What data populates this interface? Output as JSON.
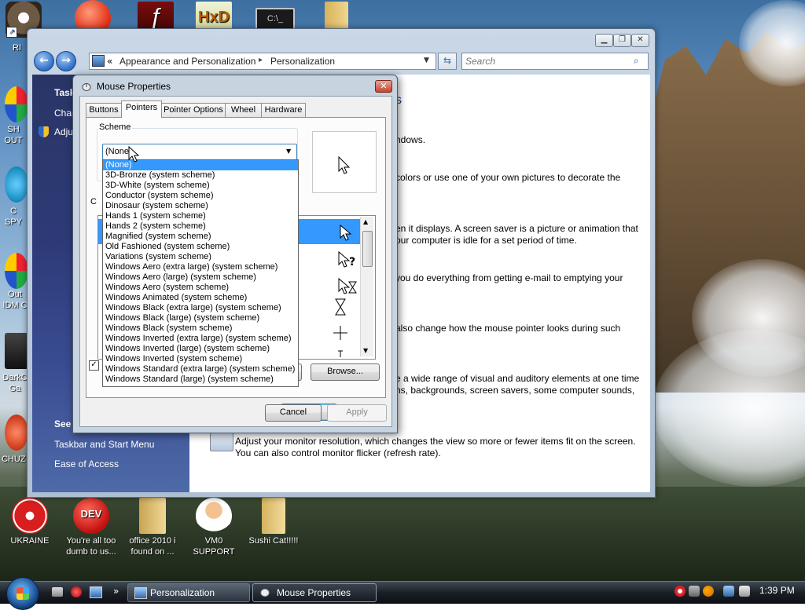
{
  "desktop": {
    "icons_top": [
      {
        "label": "RI",
        "name": "raccoon"
      },
      {
        "label": "",
        "name": "p-app"
      },
      {
        "label": "",
        "name": "flash"
      },
      {
        "label": "",
        "name": "hxd"
      },
      {
        "label": "",
        "name": "cmd"
      },
      {
        "label": "",
        "name": "folder"
      }
    ],
    "icons_left": [
      {
        "label": "SH OUT",
        "name": "sh-out"
      },
      {
        "label": "C SPY",
        "name": "spy"
      },
      {
        "label": "Out IDM C",
        "name": "idm"
      },
      {
        "label": "DarkC Ga",
        "name": "darkc"
      },
      {
        "label": "CHUZ",
        "name": "chuz"
      }
    ],
    "icons_bottom": [
      {
        "label": "UKRAINE",
        "name": "ukraine"
      },
      {
        "label": "You're all too dumb to us...",
        "name": "devcpp"
      },
      {
        "label": "office 2010 i found on ...",
        "name": "office"
      },
      {
        "label": "VM0 SUPPORT",
        "name": "vm0"
      },
      {
        "label": "Sushi Cat!!!!!",
        "name": "sushi"
      }
    ]
  },
  "explorer": {
    "breadcrumb": [
      "Appearance and Personalization",
      "Personalization"
    ],
    "search_placeholder": "Search",
    "left_pane": {
      "top_items": [
        "Task",
        "Char",
        "Adju"
      ],
      "see_also": "See",
      "links": [
        "Taskbar and Start Menu",
        "Ease of Access"
      ]
    },
    "content_fragments": [
      "s",
      "ndows.",
      "colors or use one of your own pictures to decorate the",
      "en it displays. A screen saver is a picture or animation that",
      "our computer is idle for a set period of time.",
      "you do everything from getting e-mail to emptying your",
      "also change how the mouse pointer looks during such",
      "e a wide range of visual and auditory elements at one time",
      "ns, backgrounds, screen savers, some computer sounds,",
      "Adjust your monitor resolution, which changes the view so more or fewer items fit on the screen.",
      "You can also control monitor flicker (refresh rate)."
    ]
  },
  "dialog": {
    "title": "Mouse Properties",
    "tabs": [
      "Buttons",
      "Pointers",
      "Pointer Options",
      "Wheel",
      "Hardware"
    ],
    "active_tab": "Pointers",
    "scheme_label": "Scheme",
    "scheme_value": "(None)",
    "customize_label_fragment": "C",
    "scheme_options": [
      "(None)",
      "3D-Bronze (system scheme)",
      "3D-White (system scheme)",
      "Conductor (system scheme)",
      "Dinosaur (system scheme)",
      "Hands 1 (system scheme)",
      "Hands 2 (system scheme)",
      "Magnified (system scheme)",
      "Old Fashioned (system scheme)",
      "Variations (system scheme)",
      "Windows Aero (extra large) (system scheme)",
      "Windows Aero (large) (system scheme)",
      "Windows Aero (system scheme)",
      "Windows Animated (system scheme)",
      "Windows Black (extra large) (system scheme)",
      "Windows Black (large) (system scheme)",
      "Windows Black (system scheme)",
      "Windows Inverted (extra large) (system scheme)",
      "Windows Inverted (large) (system scheme)",
      "Windows Inverted (system scheme)",
      "Windows Standard (extra large) (system scheme)",
      "Windows Standard (large) (system scheme)"
    ],
    "buttons": {
      "browse": "Browse...",
      "default_fragment": "lt",
      "ok": "OK",
      "cancel": "Cancel",
      "apply": "Apply"
    }
  },
  "taskbar": {
    "tasks": [
      "Personalization",
      "Mouse Properties"
    ],
    "clock": "1:39 PM",
    "chevron": "»"
  },
  "colors": {
    "selection": "#3399ff",
    "taskbar": "#1b1f26",
    "left_pane": "#2d3a77"
  }
}
